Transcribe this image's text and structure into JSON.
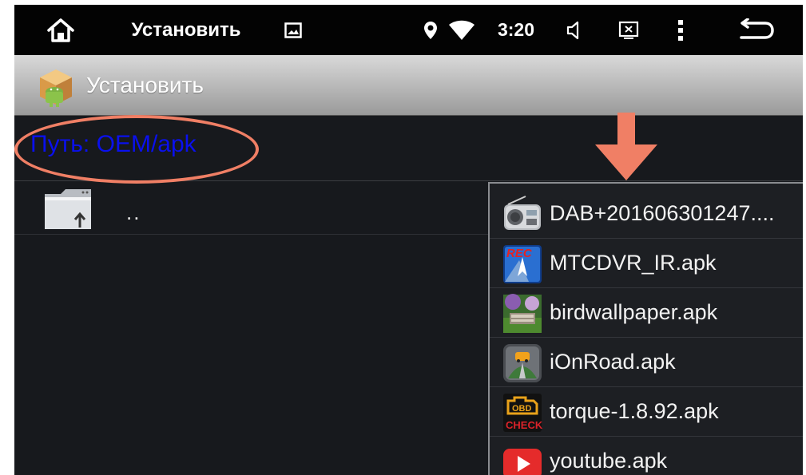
{
  "statusbar": {
    "title": "Установить",
    "time": "3:20",
    "icons": [
      "home-icon",
      "image-icon",
      "location-icon",
      "wifi-icon",
      "volume-icon",
      "screenshot-icon",
      "overflow-menu-icon",
      "back-icon"
    ]
  },
  "actionbar": {
    "title": "Установить",
    "icon": "android-package-icon"
  },
  "path": {
    "label": "Путь:",
    "value": "OEM/apk"
  },
  "updir": {
    "label": "..",
    "icon": "folder-up-icon"
  },
  "annotations": {
    "highlight_color": "#f07f65"
  },
  "files": [
    {
      "name": "DAB+201606301247....",
      "icon": "radio-icon"
    },
    {
      "name": "MTCDVR_IR.apk",
      "icon": "rec-navigation-icon"
    },
    {
      "name": "birdwallpaper.apk",
      "icon": "bird-wallpaper-icon"
    },
    {
      "name": "iOnRoad.apk",
      "icon": "ionroad-car-icon"
    },
    {
      "name": "torque-1.8.92.apk",
      "icon": "obd-check-icon"
    },
    {
      "name": "youtube.apk",
      "icon": "youtube-icon"
    }
  ]
}
